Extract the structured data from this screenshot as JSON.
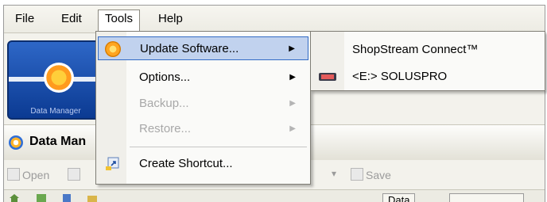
{
  "menubar": {
    "file": "File",
    "edit": "Edit",
    "tools": "Tools",
    "help": "Help"
  },
  "app": {
    "logo_caption": "Data Manager",
    "title": "Data Man"
  },
  "toolbar": {
    "open": "Open",
    "save": "Save",
    "bottom_button_1": "Data"
  },
  "tools_menu": {
    "items": [
      {
        "label": "Update Software...",
        "enabled": true,
        "submenu": true,
        "icon": "update-icon"
      },
      {
        "label": "Options...",
        "enabled": true,
        "submenu": true
      },
      {
        "label": "Backup...",
        "enabled": false,
        "submenu": true
      },
      {
        "label": "Restore...",
        "enabled": false,
        "submenu": true
      },
      {
        "label": "Create Shortcut...",
        "enabled": true,
        "submenu": false,
        "icon": "shortcut-icon"
      }
    ]
  },
  "update_submenu": {
    "items": [
      {
        "label": "ShopStream Connect™"
      },
      {
        "label": "<E:> SOLUSPRO",
        "icon": "usb-drive-icon"
      }
    ]
  },
  "colors": {
    "highlight": "#c1d2ee",
    "highlight_border": "#316ac5",
    "logo_blue": "#1a4fb0"
  }
}
